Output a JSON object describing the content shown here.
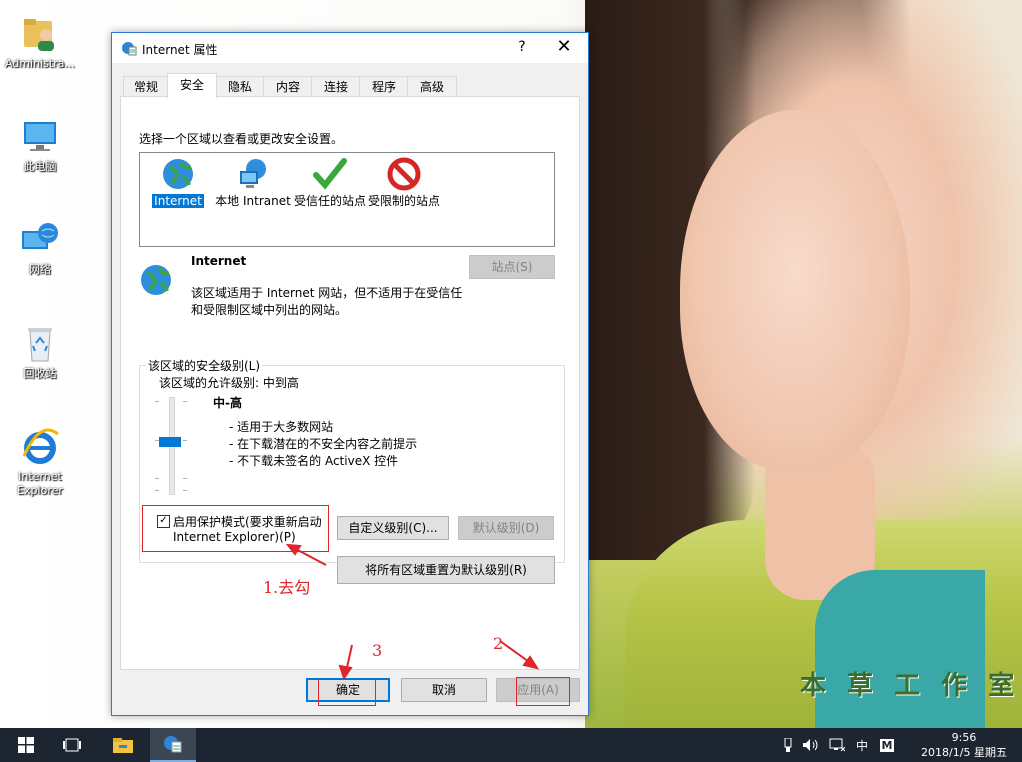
{
  "desktop": {
    "icons": [
      {
        "label": "Administra..."
      },
      {
        "label": "此电脑"
      },
      {
        "label": "网络"
      },
      {
        "label": "回收站"
      },
      {
        "label": "Internet Explorer"
      }
    ],
    "watermark": "本 草 工 作 室"
  },
  "dialog": {
    "title": "Internet 属性",
    "help": "?",
    "close": "✕",
    "tabs": [
      "常规",
      "安全",
      "隐私",
      "内容",
      "连接",
      "程序",
      "高级"
    ],
    "active_tab": "安全",
    "instruction": "选择一个区域以查看或更改安全设置。",
    "zones": [
      {
        "label": "Internet"
      },
      {
        "label": "本地 Intranet"
      },
      {
        "label": "受信任的站点"
      },
      {
        "label": "受限制的站点"
      }
    ],
    "zone_title": "Internet",
    "zone_desc_1": "该区域适用于 Internet 网站，但不适用于在受信任",
    "zone_desc_2": "和受限制区域中列出的网站。",
    "sites_button": "站点(S)",
    "security_group_label": "该区域的安全级别(L)",
    "allowed_levels": "该区域的允许级别: 中到高",
    "level_name": "中-高",
    "level_points": [
      "- 适用于大多数网站",
      "- 在下载潜在的不安全内容之前提示",
      "- 不下载未签名的 ActiveX 控件"
    ],
    "protected_mode": {
      "line1": "启用保护模式(要求重新启动",
      "line2": "Internet Explorer)(P)",
      "checked": true
    },
    "custom_level_button": "自定义级别(C)...",
    "default_level_button": "默认级别(D)",
    "reset_all_button": "将所有区域重置为默认级别(R)",
    "ok_button": "确定",
    "cancel_button": "取消",
    "apply_button": "应用(A)"
  },
  "annotations": {
    "step1": "1.去勾",
    "step2": "2",
    "step3": "3"
  },
  "taskbar": {
    "ime": "中",
    "ime_mode": "M",
    "time": "9:56",
    "date": "2018/1/5 星期五"
  },
  "colors": {
    "accent": "#0078d7",
    "annotation_red": "#e0242b",
    "taskbar": "#1c2530"
  }
}
